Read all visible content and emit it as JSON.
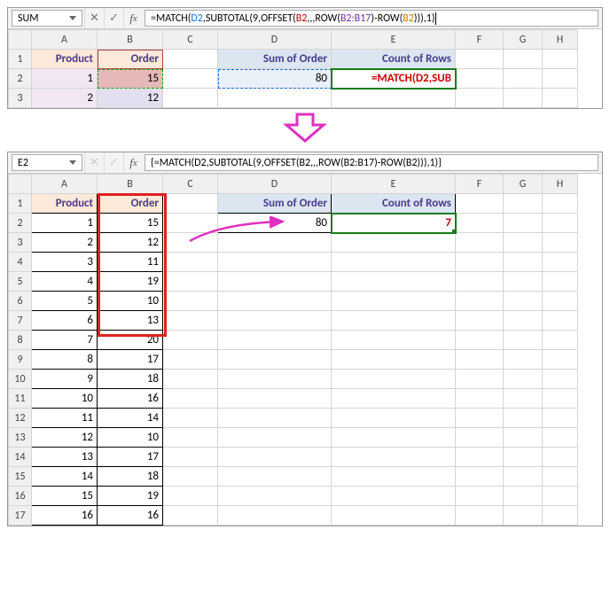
{
  "top": {
    "nameBox": "SUM",
    "formulaParts": {
      "p0": "=",
      "p1": "MATCH",
      "p2": "(",
      "p3": "D2",
      "p4": ",",
      "p5": "SUBTOTAL",
      "p6": "(9,",
      "p7": "OFFSET",
      "p8": "(",
      "p9": "B2",
      "p10": ",,,",
      "p11": "ROW",
      "p12": "(",
      "p13": "B2:B17",
      "p14": ")-",
      "p15": "ROW",
      "p16": "(",
      "p17": "B2",
      "p18": "))),1)"
    },
    "cols": [
      "A",
      "B",
      "C",
      "D",
      "E",
      "F",
      "G",
      "H"
    ],
    "rows": [
      "1",
      "2",
      "3"
    ],
    "headers": {
      "A1": "Product",
      "B1": "Order",
      "D1": "Sum of Order",
      "E1": "Count of Rows"
    },
    "cells": {
      "A2": "1",
      "B2": "15",
      "A3": "2",
      "B3": "12",
      "D2": "80",
      "E2_edit": "=MATCH(D2,SUB"
    }
  },
  "bottom": {
    "nameBox": "E2",
    "formula": "{=MATCH(D2,SUBTOTAL(9,OFFSET(B2,,,ROW(B2:B17)-ROW(B2))),1)}",
    "cols": [
      "A",
      "B",
      "C",
      "D",
      "E",
      "F",
      "G",
      "H"
    ],
    "headers": {
      "A1": "Product",
      "B1": "Order",
      "D1": "Sum of Order",
      "E1": "Count of Rows"
    },
    "D2": "80",
    "E2": "7",
    "rows": [
      {
        "r": "1"
      },
      {
        "r": "2",
        "A": "1",
        "B": "15"
      },
      {
        "r": "3",
        "A": "2",
        "B": "12"
      },
      {
        "r": "4",
        "A": "3",
        "B": "11"
      },
      {
        "r": "5",
        "A": "4",
        "B": "19"
      },
      {
        "r": "6",
        "A": "5",
        "B": "10"
      },
      {
        "r": "7",
        "A": "6",
        "B": "13"
      },
      {
        "r": "8",
        "A": "7",
        "B": "20"
      },
      {
        "r": "9",
        "A": "8",
        "B": "17"
      },
      {
        "r": "10",
        "A": "9",
        "B": "18"
      },
      {
        "r": "11",
        "A": "10",
        "B": "16"
      },
      {
        "r": "12",
        "A": "11",
        "B": "14"
      },
      {
        "r": "13",
        "A": "12",
        "B": "10"
      },
      {
        "r": "14",
        "A": "13",
        "B": "17"
      },
      {
        "r": "15",
        "A": "14",
        "B": "18"
      },
      {
        "r": "16",
        "A": "15",
        "B": "19"
      },
      {
        "r": "17",
        "A": "16",
        "B": "16"
      }
    ]
  },
  "chart_data": {
    "type": "table",
    "title": "Product vs Order with running-sum row count",
    "columns": [
      "Product",
      "Order"
    ],
    "rows": [
      [
        1,
        15
      ],
      [
        2,
        12
      ],
      [
        3,
        11
      ],
      [
        4,
        19
      ],
      [
        5,
        10
      ],
      [
        6,
        13
      ],
      [
        7,
        20
      ],
      [
        8,
        17
      ],
      [
        9,
        18
      ],
      [
        10,
        16
      ],
      [
        11,
        14
      ],
      [
        12,
        10
      ],
      [
        13,
        17
      ],
      [
        14,
        18
      ],
      [
        15,
        19
      ],
      [
        16,
        16
      ]
    ],
    "summary": {
      "Sum of Order": 80,
      "Count of Rows": 7
    }
  }
}
